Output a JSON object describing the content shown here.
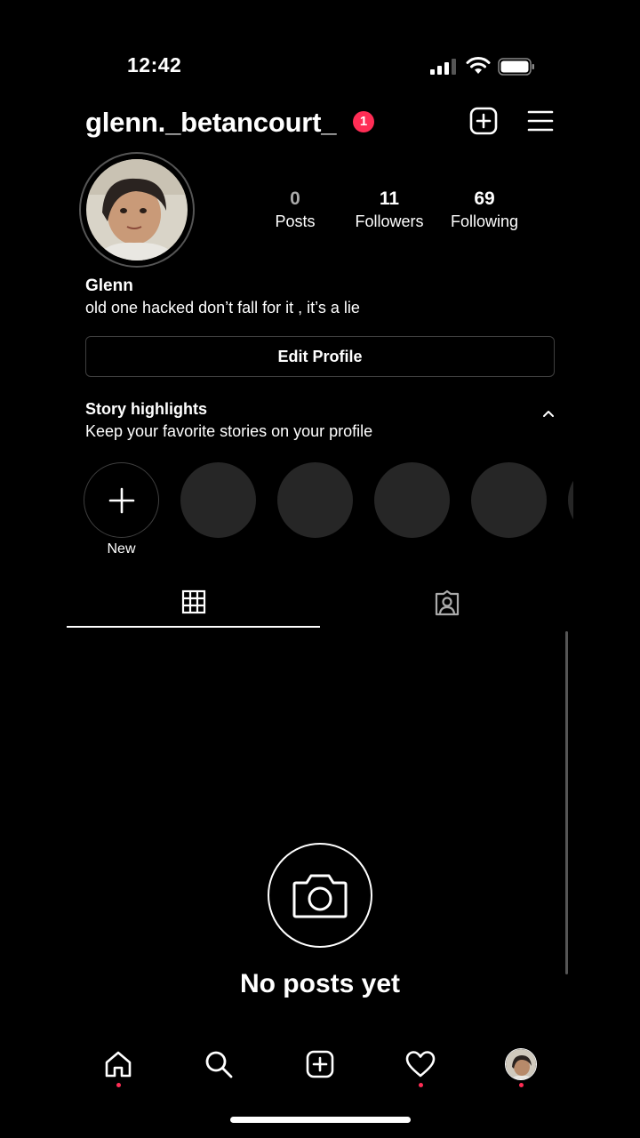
{
  "status_bar": {
    "time": "12:42",
    "icons": [
      "cellular-signal-icon",
      "wifi-icon",
      "battery-icon"
    ]
  },
  "header": {
    "username": "glenn._betancourt_",
    "notification_count": "1",
    "icons": [
      "new-post-icon",
      "menu-icon"
    ]
  },
  "profile": {
    "stats": [
      {
        "value": "0",
        "label": "Posts"
      },
      {
        "value": "11",
        "label": "Followers"
      },
      {
        "value": "69",
        "label": "Following"
      }
    ],
    "name": "Glenn",
    "bio": "old one hacked don’t fall for it , it’s a lie",
    "edit_label": "Edit Profile"
  },
  "highlights": {
    "title": "Story highlights",
    "subtitle": "Keep your favorite stories on your profile",
    "new_label": "New"
  },
  "tabs": [
    "grid-icon",
    "tagged-icon"
  ],
  "empty_state": {
    "icon": "camera-icon",
    "text": "No posts yet"
  },
  "bottom_nav": [
    "home-icon",
    "search-icon",
    "create-icon",
    "activity-heart-icon",
    "profile-avatar"
  ],
  "colors": {
    "background": "#000000",
    "badge": "#ff2d55",
    "placeholder": "#262626",
    "border": "#3f3f3f"
  }
}
